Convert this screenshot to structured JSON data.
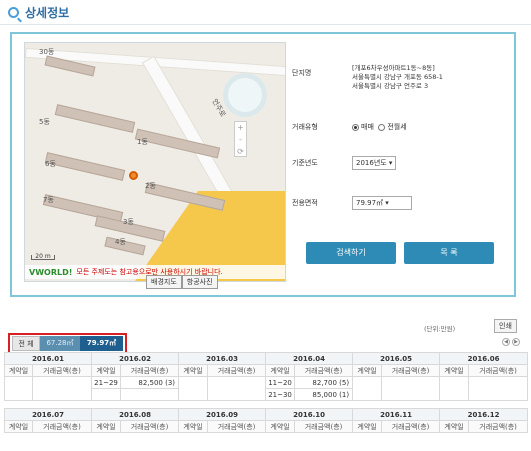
{
  "header": {
    "title": "상세정보"
  },
  "map": {
    "labels": {
      "b30": "30동",
      "b5": "5동",
      "b1": "1동",
      "b6": "6동",
      "b2": "2동",
      "b7": "7동",
      "b3": "3동",
      "b4": "4동",
      "road": "언주로"
    },
    "scale": "20 m",
    "vworld_logo": "VWORLD!",
    "notice": "모든 주제도는 참고용으로만 사용하시기 바랍니다.",
    "tab_base": "배경지도",
    "tab_aerial": "항공사진"
  },
  "form": {
    "complex_label": "단지명",
    "complex_lines": [
      "[개포6차우성아파트1동~8동]",
      "서울특별시 강남구 개포동 658-1",
      "서울특별시 강남구 언주로 3"
    ],
    "deal_label": "거래유형",
    "deal_opt1": "매매",
    "deal_opt2": "전월세",
    "year_label": "기준년도",
    "year_value": "2016년도 ▾",
    "area_label": "전용면적",
    "area_value": "79.97㎡ ▾",
    "search_button": "검색하기",
    "list_button": "목 록"
  },
  "results": {
    "unit_note": "(단위:만원)",
    "print_button": "인쇄",
    "seg_all": "전 체",
    "seg_a": "67.28㎡",
    "seg_b": "79.97㎡",
    "col_day": "계약일",
    "col_amount": "거래금액(층)",
    "months_top": [
      "2016.01",
      "2016.02",
      "2016.03",
      "2016.04",
      "2016.05",
      "2016.06"
    ],
    "months_bottom": [
      "2016.07",
      "2016.08",
      "2016.09",
      "2016.10",
      "2016.11",
      "2016.12"
    ],
    "feb_day": "21~29",
    "feb_amt": "82,500 (3)",
    "apr_day1": "11~20",
    "apr_amt1": "82,700 (5)",
    "apr_day2": "21~30",
    "apr_amt2": "85,000 (1)"
  },
  "colors": {
    "accent": "#2e8bb5",
    "highlight": "#d71f26",
    "panel_border": "#7fc6d8"
  }
}
